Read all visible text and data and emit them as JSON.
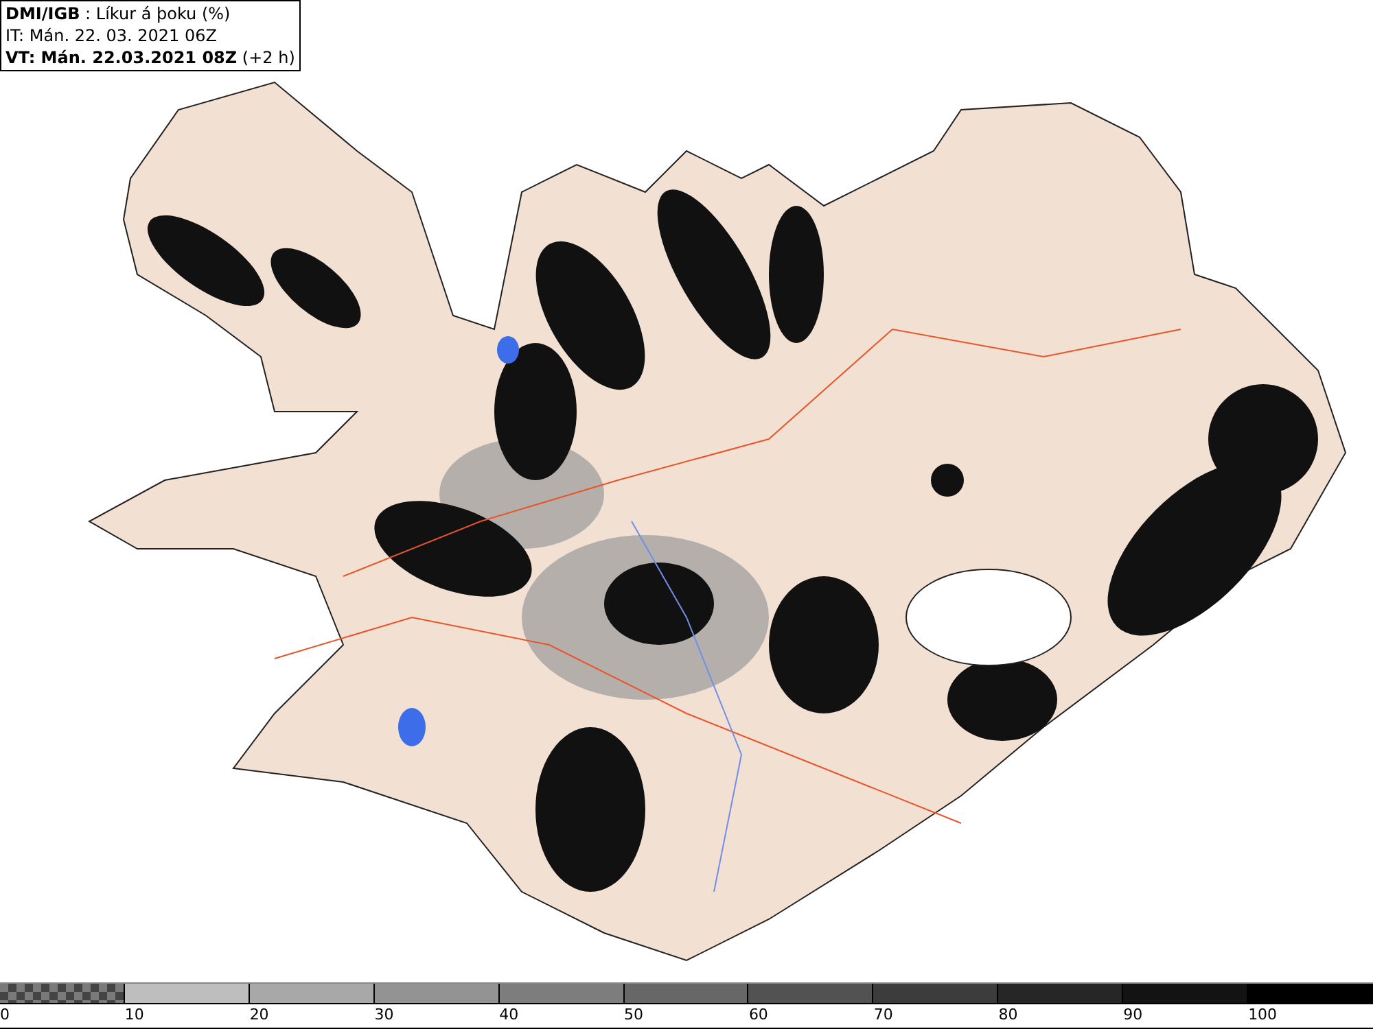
{
  "header": {
    "lines": [
      "**DMI/IGB** : Líkur á þoku (%)",
      "IT: Mán. 22. 03. 2021 06Z",
      "**VT: Mán. 22.03.2021 08Z** (+2 h)"
    ]
  },
  "legend": [
    {
      "label": "0",
      "kind": "checker"
    },
    {
      "label": "10",
      "kind": "solid",
      "color": "#bebebe"
    },
    {
      "label": "20",
      "kind": "solid",
      "color": "#a8a8a8"
    },
    {
      "label": "30",
      "kind": "solid",
      "color": "#939393"
    },
    {
      "label": "40",
      "kind": "solid",
      "color": "#7d7d7d"
    },
    {
      "label": "50",
      "kind": "solid",
      "color": "#676767"
    },
    {
      "label": "60",
      "kind": "solid",
      "color": "#525252"
    },
    {
      "label": "70",
      "kind": "solid",
      "color": "#3c3c3c"
    },
    {
      "label": "80",
      "kind": "solid",
      "color": "#262626"
    },
    {
      "label": "90",
      "kind": "solid",
      "color": "#131313"
    },
    {
      "label": "100",
      "kind": "solid",
      "color": "#000000"
    }
  ]
}
